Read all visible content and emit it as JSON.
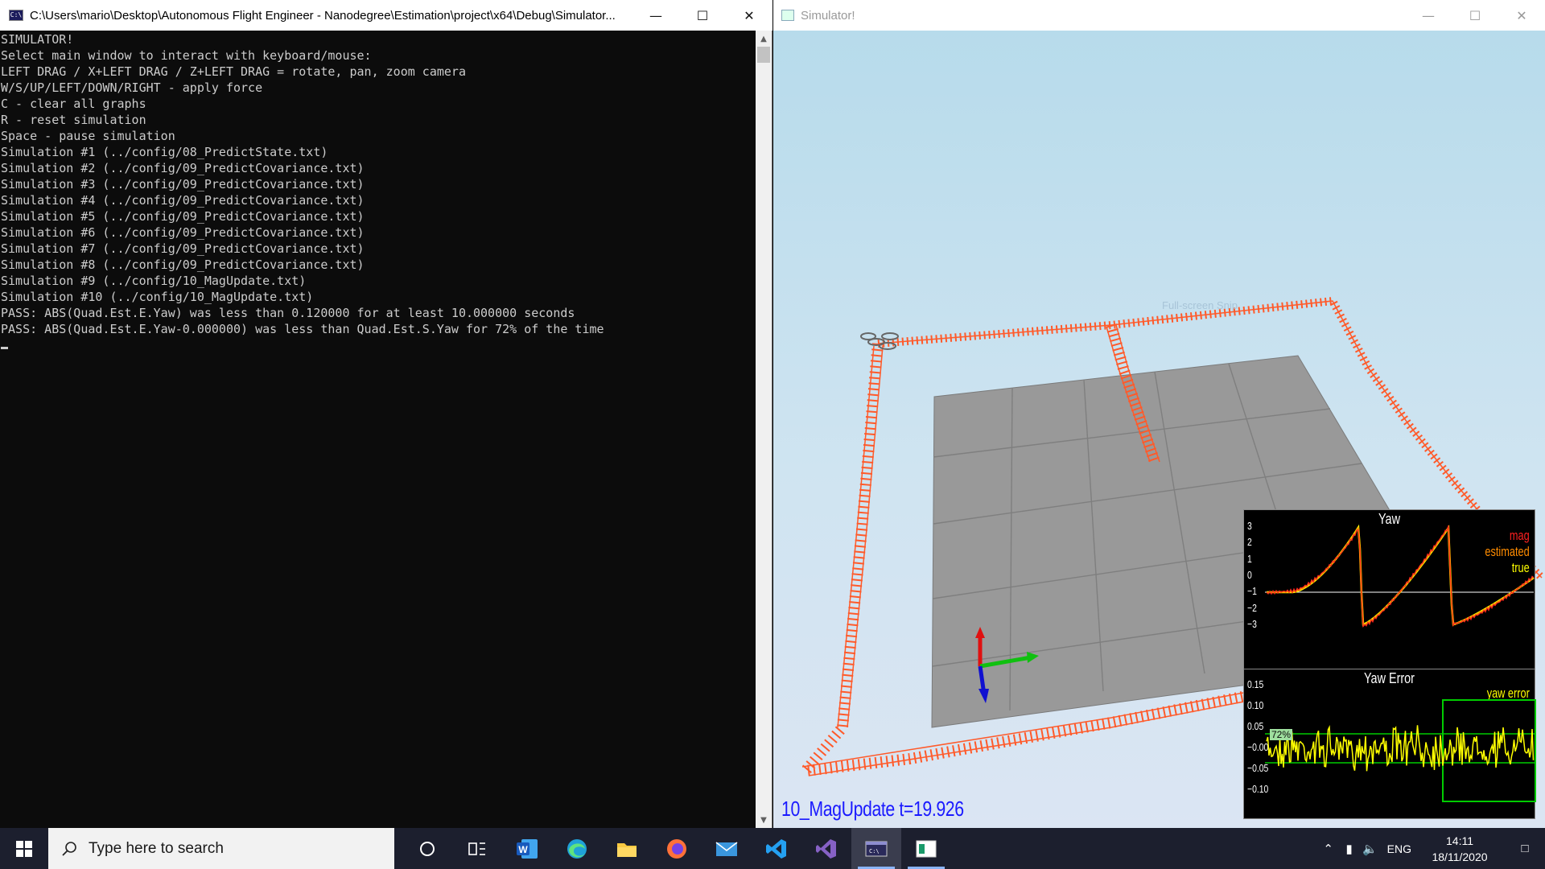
{
  "console": {
    "title": "C:\\Users\\mario\\Desktop\\Autonomous Flight  Engineer - Nanodegree\\Estimation\\project\\x64\\Debug\\Simulator...",
    "lines": [
      "SIMULATOR!",
      "Select main window to interact with keyboard/mouse:",
      "LEFT DRAG / X+LEFT DRAG / Z+LEFT DRAG = rotate, pan, zoom camera",
      "W/S/UP/LEFT/DOWN/RIGHT - apply force",
      "C - clear all graphs",
      "R - reset simulation",
      "Space - pause simulation",
      "Simulation #1 (../config/08_PredictState.txt)",
      "Simulation #2 (../config/09_PredictCovariance.txt)",
      "Simulation #3 (../config/09_PredictCovariance.txt)",
      "Simulation #4 (../config/09_PredictCovariance.txt)",
      "Simulation #5 (../config/09_PredictCovariance.txt)",
      "Simulation #6 (../config/09_PredictCovariance.txt)",
      "Simulation #7 (../config/09_PredictCovariance.txt)",
      "Simulation #8 (../config/09_PredictCovariance.txt)",
      "Simulation #9 (../config/10_MagUpdate.txt)",
      "Simulation #10 (../config/10_MagUpdate.txt)",
      "PASS: ABS(Quad.Est.E.Yaw) was less than 0.120000 for at least 10.000000 seconds",
      "PASS: ABS(Quad.Est.E.Yaw-0.000000) was less than Quad.Est.S.Yaw for 72% of the time"
    ]
  },
  "simulator": {
    "title": "Simulator!",
    "status": "10_MagUpdate  t=19.926",
    "snip_label": "Full-screen Snip",
    "yaw_graph": {
      "title": "Yaw",
      "ticks": [
        "3",
        "2",
        "1",
        "0",
        "−1",
        "−2",
        "−3"
      ],
      "legend": [
        {
          "label": "mag",
          "color": "#ff2020"
        },
        {
          "label": "estimated",
          "color": "#ff8c00"
        },
        {
          "label": "true",
          "color": "#ffff00"
        }
      ]
    },
    "yaw_error_graph": {
      "title": "Yaw Error",
      "ticks": [
        "0.15",
        "0.10",
        "0.05",
        "−0.00",
        "−0.05",
        "−0.10"
      ],
      "legend": [
        {
          "label": "yaw error",
          "color": "#ffff00"
        }
      ],
      "percent_label": "72%"
    }
  },
  "taskbar": {
    "search_placeholder": "Type here to search",
    "language": "ENG",
    "time": "14:11",
    "date": "18/11/2020",
    "apps": [
      "cortana-icon",
      "task-view-icon",
      "word-icon",
      "edge-icon",
      "file-explorer-icon",
      "firefox-icon",
      "mail-icon",
      "vscode-icon",
      "visual-studio-icon",
      "terminal-icon",
      "simulator-icon"
    ]
  }
}
